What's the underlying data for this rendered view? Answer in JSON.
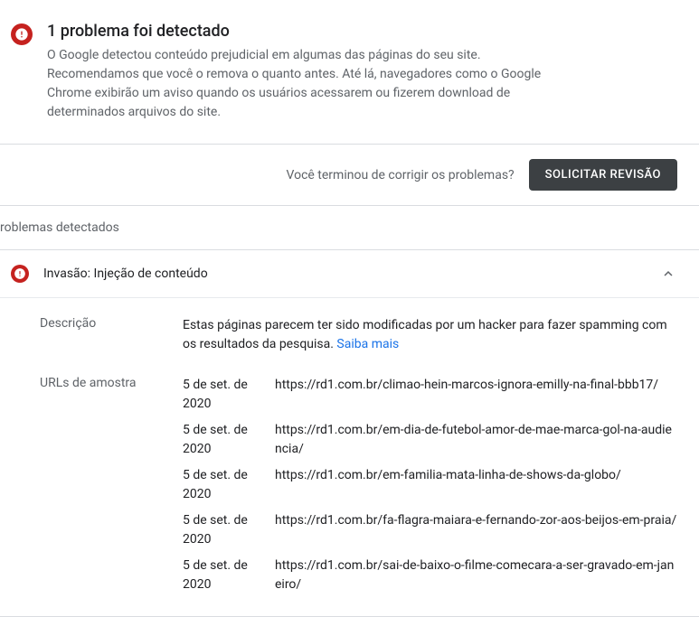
{
  "alert": {
    "title": "1 problema foi detectado",
    "description": "O Google detectou conteúdo prejudicial em algumas das páginas do seu site. Recomendamos que você o remova o quanto antes. Até lá, navegadores como o Google Chrome exibirão um aviso quando os usuários acessarem ou fizerem download de determinados arquivos do site."
  },
  "action": {
    "prompt": "Você terminou de corrigir os problemas?",
    "button": "SOLICITAR REVISÃO"
  },
  "section_header": "roblemas detectados",
  "panel": {
    "title": "Invasão: Injeção de conteúdo",
    "description_label": "Descrição",
    "description_text": "Estas páginas parecem ter sido modificadas por um hacker para fazer spamming com os resultados da pesquisa. ",
    "learn_more": "Saiba mais",
    "urls_label": "URLs de amostra",
    "urls": [
      {
        "date": "5 de set. de 2020",
        "url": "https://rd1.com.br/climao-hein-marcos-ignora-emilly-na-final-bbb17/"
      },
      {
        "date": "5 de set. de 2020",
        "url": "https://rd1.com.br/em-dia-de-futebol-amor-de-mae-marca-gol-na-audiencia/"
      },
      {
        "date": "5 de set. de 2020",
        "url": "https://rd1.com.br/em-familia-mata-linha-de-shows-da-globo/"
      },
      {
        "date": "5 de set. de 2020",
        "url": "https://rd1.com.br/fa-flagra-maiara-e-fernando-zor-aos-beijos-em-praia/"
      },
      {
        "date": "5 de set. de 2020",
        "url": "https://rd1.com.br/sai-de-baixo-o-filme-comecara-a-ser-gravado-em-janeiro/"
      }
    ]
  }
}
